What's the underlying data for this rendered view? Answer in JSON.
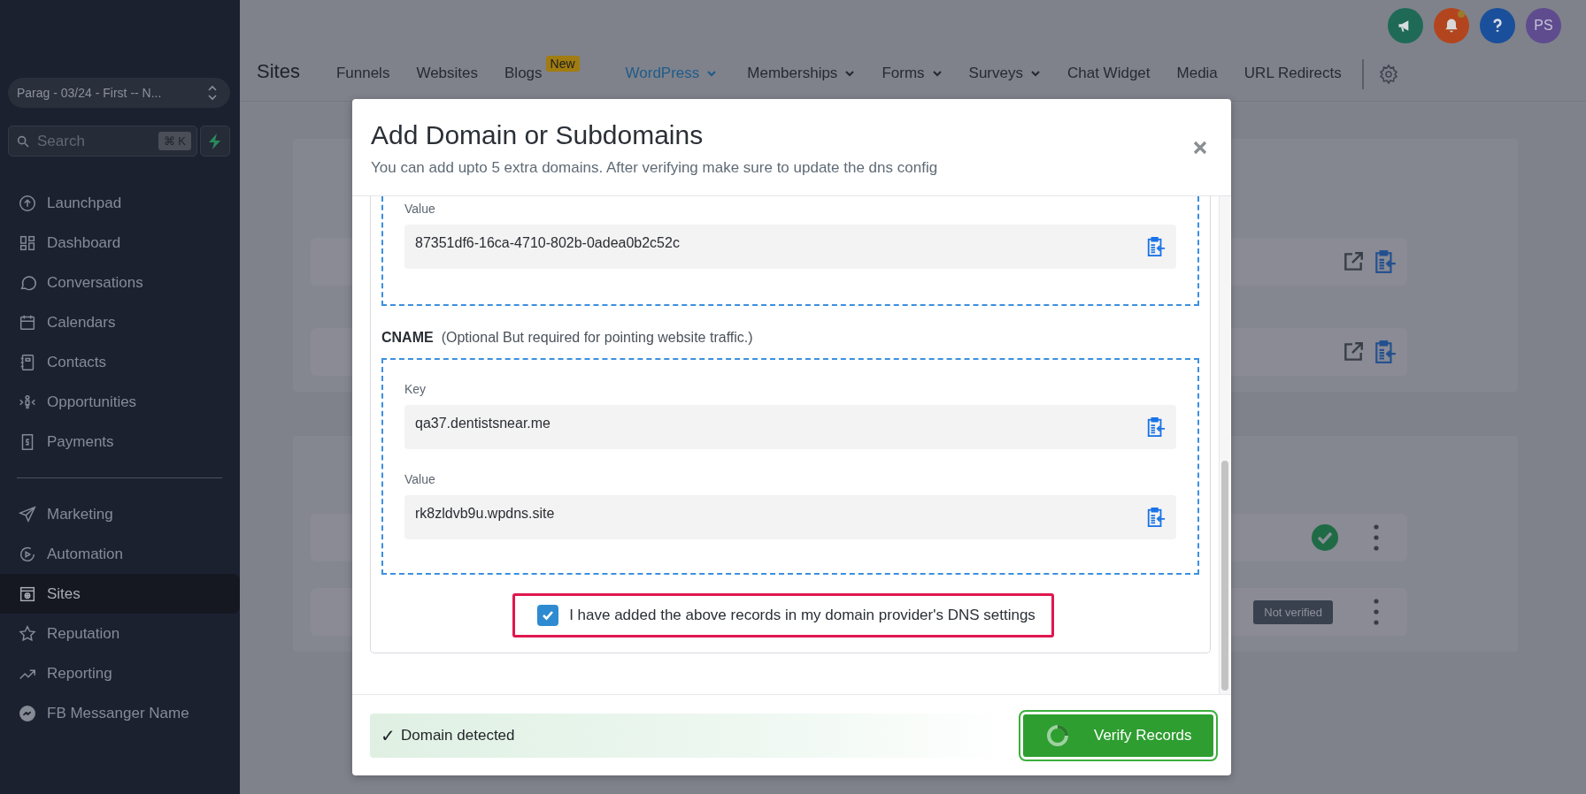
{
  "sidebar": {
    "account": "Parag - 03/24 - First -- N...",
    "search": {
      "placeholder": "Search",
      "shortcut": "⌘ K"
    },
    "groups": [
      [
        {
          "label": "Launchpad",
          "selected": false
        },
        {
          "label": "Dashboard",
          "selected": false
        },
        {
          "label": "Conversations",
          "selected": false
        },
        {
          "label": "Calendars",
          "selected": false
        },
        {
          "label": "Contacts",
          "selected": false
        },
        {
          "label": "Opportunities",
          "selected": false
        },
        {
          "label": "Payments",
          "selected": false
        }
      ],
      [
        {
          "label": "Marketing",
          "selected": false
        },
        {
          "label": "Automation",
          "selected": false
        },
        {
          "label": "Sites",
          "selected": true
        },
        {
          "label": "Reputation",
          "selected": false
        },
        {
          "label": "Reporting",
          "selected": false
        },
        {
          "label": "FB Messanger Name",
          "selected": false
        }
      ]
    ]
  },
  "header": {
    "avatar": "PS",
    "notification_dot": true
  },
  "nav": {
    "title": "Sites",
    "tabs": [
      {
        "label": "Funnels",
        "selected": false,
        "menu": false
      },
      {
        "label": "Websites",
        "selected": false,
        "menu": false
      },
      {
        "label": "Blogs",
        "selected": false,
        "menu": false,
        "badge": "New"
      },
      {
        "label": "WordPress",
        "selected": true,
        "menu": true
      },
      {
        "label": "Memberships",
        "selected": false,
        "menu": true
      },
      {
        "label": "Forms",
        "selected": false,
        "menu": true
      },
      {
        "label": "Surveys",
        "selected": false,
        "menu": true
      },
      {
        "label": "Chat Widget",
        "selected": false,
        "menu": false
      },
      {
        "label": "Media",
        "selected": false,
        "menu": false
      },
      {
        "label": "URL Redirects",
        "selected": false,
        "menu": false
      }
    ]
  },
  "background": {
    "cards": [
      {
        "rows": [
          {
            "kind": "links"
          },
          {
            "kind": "links"
          }
        ]
      },
      {
        "rows": [
          {
            "kind": "verified"
          },
          {
            "kind": "tags",
            "tags": [
              "Not verified"
            ]
          }
        ]
      }
    ]
  },
  "modal": {
    "title": "Add Domain or Subdomains",
    "subtitle": "You can add upto 5 extra domains. After verifying make sure to update the dns config",
    "records": [
      {
        "fields": [
          {
            "label": "Value",
            "value": "87351df6-16ca-4710-802b-0adea0b2c52c"
          }
        ]
      },
      {
        "heading": "CNAME",
        "note": "(Optional But required for pointing website traffic.)",
        "fields": [
          {
            "label": "Key",
            "value": "qa37.dentistsnear.me"
          },
          {
            "label": "Value",
            "value": "rk8zldvb9u.wpdns.site"
          }
        ]
      }
    ],
    "confirmation": {
      "label": "I have added the above records in my domain provider's DNS settings",
      "checked": true
    },
    "status": {
      "mark": "✓",
      "text": "Domain detected"
    },
    "button": {
      "label": "Verify Records",
      "loading": true
    }
  }
}
